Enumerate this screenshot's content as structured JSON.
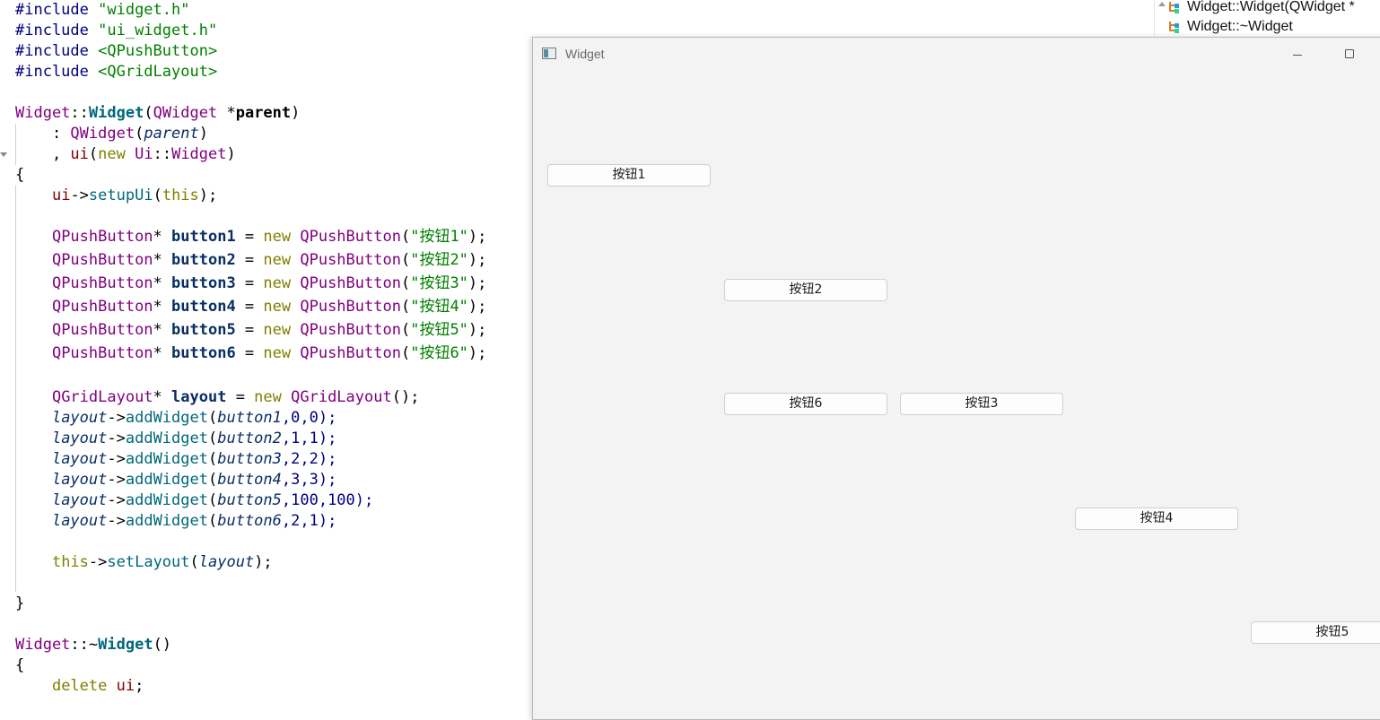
{
  "code": {
    "lines": [
      [
        {
          "t": "#include ",
          "c": "pp"
        },
        {
          "t": "\"widget.h\"",
          "c": "str"
        }
      ],
      [
        {
          "t": "#include ",
          "c": "pp"
        },
        {
          "t": "\"ui_widget.h\"",
          "c": "str"
        }
      ],
      [
        {
          "t": "#include ",
          "c": "pp"
        },
        {
          "t": "<QPushButton>",
          "c": "inc"
        }
      ],
      [
        {
          "t": "#include ",
          "c": "pp"
        },
        {
          "t": "<QGridLayout>",
          "c": "inc"
        }
      ],
      [],
      [
        {
          "t": "Widget",
          "c": "cls"
        },
        {
          "t": "::",
          "c": "op"
        },
        {
          "t": "Widget",
          "c": "fnd"
        },
        {
          "t": "(",
          "c": "op"
        },
        {
          "t": "QWidget",
          "c": "cls"
        },
        {
          "t": " *",
          "c": "op"
        },
        {
          "t": "parent",
          "c": "prmb"
        },
        {
          "t": ")",
          "c": "op"
        }
      ],
      [
        {
          "t": "    : ",
          "c": "op"
        },
        {
          "t": "QWidget",
          "c": "cls"
        },
        {
          "t": "(",
          "c": "op"
        },
        {
          "t": "parent",
          "c": "prm"
        },
        {
          "t": ")",
          "c": "op"
        }
      ],
      [
        {
          "t": "    , ",
          "c": "op"
        },
        {
          "t": "ui",
          "c": "mem"
        },
        {
          "t": "(",
          "c": "op"
        },
        {
          "t": "new ",
          "c": "kw"
        },
        {
          "t": "Ui",
          "c": "cls"
        },
        {
          "t": "::",
          "c": "op"
        },
        {
          "t": "Widget",
          "c": "cls"
        },
        {
          "t": ")",
          "c": "op"
        }
      ],
      [
        {
          "t": "{",
          "c": "op"
        }
      ],
      [
        {
          "t": "    ",
          "c": "op"
        },
        {
          "t": "ui",
          "c": "mem"
        },
        {
          "t": "->",
          "c": "op"
        },
        {
          "t": "setupUi",
          "c": "fn"
        },
        {
          "t": "(",
          "c": "op"
        },
        {
          "t": "this",
          "c": "kw"
        },
        {
          "t": ");",
          "c": "op"
        }
      ],
      [],
      [
        {
          "t": "    ",
          "c": "op"
        },
        {
          "t": "QPushButton",
          "c": "cls"
        },
        {
          "t": "* ",
          "c": "op"
        },
        {
          "t": "button1",
          "c": "loc"
        },
        {
          "t": " = ",
          "c": "op"
        },
        {
          "t": "new ",
          "c": "kw"
        },
        {
          "t": "QPushButton",
          "c": "cls"
        },
        {
          "t": "(",
          "c": "op"
        },
        {
          "t": "\"按钮1\"",
          "c": "str"
        },
        {
          "t": ");",
          "c": "op"
        }
      ],
      [
        {
          "t": "    ",
          "c": "op"
        },
        {
          "t": "QPushButton",
          "c": "cls"
        },
        {
          "t": "* ",
          "c": "op"
        },
        {
          "t": "button2",
          "c": "loc"
        },
        {
          "t": " = ",
          "c": "op"
        },
        {
          "t": "new ",
          "c": "kw"
        },
        {
          "t": "QPushButton",
          "c": "cls"
        },
        {
          "t": "(",
          "c": "op"
        },
        {
          "t": "\"按钮2\"",
          "c": "str"
        },
        {
          "t": ");",
          "c": "op"
        }
      ],
      [
        {
          "t": "    ",
          "c": "op"
        },
        {
          "t": "QPushButton",
          "c": "cls"
        },
        {
          "t": "* ",
          "c": "op"
        },
        {
          "t": "button3",
          "c": "loc"
        },
        {
          "t": " = ",
          "c": "op"
        },
        {
          "t": "new ",
          "c": "kw"
        },
        {
          "t": "QPushButton",
          "c": "cls"
        },
        {
          "t": "(",
          "c": "op"
        },
        {
          "t": "\"按钮3\"",
          "c": "str"
        },
        {
          "t": ");",
          "c": "op"
        }
      ],
      [
        {
          "t": "    ",
          "c": "op"
        },
        {
          "t": "QPushButton",
          "c": "cls"
        },
        {
          "t": "* ",
          "c": "op"
        },
        {
          "t": "button4",
          "c": "loc"
        },
        {
          "t": " = ",
          "c": "op"
        },
        {
          "t": "new ",
          "c": "kw"
        },
        {
          "t": "QPushButton",
          "c": "cls"
        },
        {
          "t": "(",
          "c": "op"
        },
        {
          "t": "\"按钮4\"",
          "c": "str"
        },
        {
          "t": ");",
          "c": "op"
        }
      ],
      [
        {
          "t": "    ",
          "c": "op"
        },
        {
          "t": "QPushButton",
          "c": "cls"
        },
        {
          "t": "* ",
          "c": "op"
        },
        {
          "t": "button5",
          "c": "loc"
        },
        {
          "t": " = ",
          "c": "op"
        },
        {
          "t": "new ",
          "c": "kw"
        },
        {
          "t": "QPushButton",
          "c": "cls"
        },
        {
          "t": "(",
          "c": "op"
        },
        {
          "t": "\"按钮5\"",
          "c": "str"
        },
        {
          "t": ");",
          "c": "op"
        }
      ],
      [
        {
          "t": "    ",
          "c": "op"
        },
        {
          "t": "QPushButton",
          "c": "cls"
        },
        {
          "t": "* ",
          "c": "op"
        },
        {
          "t": "button6",
          "c": "loc"
        },
        {
          "t": " = ",
          "c": "op"
        },
        {
          "t": "new ",
          "c": "kw"
        },
        {
          "t": "QPushButton",
          "c": "cls"
        },
        {
          "t": "(",
          "c": "op"
        },
        {
          "t": "\"按钮6\"",
          "c": "str"
        },
        {
          "t": ");",
          "c": "op"
        }
      ],
      [],
      [
        {
          "t": "    ",
          "c": "op"
        },
        {
          "t": "QGridLayout",
          "c": "cls"
        },
        {
          "t": "* ",
          "c": "op"
        },
        {
          "t": "layout",
          "c": "loc"
        },
        {
          "t": " = ",
          "c": "op"
        },
        {
          "t": "new ",
          "c": "kw"
        },
        {
          "t": "QGridLayout",
          "c": "cls"
        },
        {
          "t": "();",
          "c": "op"
        }
      ],
      [
        {
          "t": "    ",
          "c": "op"
        },
        {
          "t": "layout",
          "c": "prm"
        },
        {
          "t": "->",
          "c": "op"
        },
        {
          "t": "addWidget",
          "c": "fn"
        },
        {
          "t": "(",
          "c": "op"
        },
        {
          "t": "button1",
          "c": "prm"
        },
        {
          "t": ",0,0);",
          "c": "num"
        }
      ],
      [
        {
          "t": "    ",
          "c": "op"
        },
        {
          "t": "layout",
          "c": "prm"
        },
        {
          "t": "->",
          "c": "op"
        },
        {
          "t": "addWidget",
          "c": "fn"
        },
        {
          "t": "(",
          "c": "op"
        },
        {
          "t": "button2",
          "c": "prm"
        },
        {
          "t": ",1,1);",
          "c": "num"
        }
      ],
      [
        {
          "t": "    ",
          "c": "op"
        },
        {
          "t": "layout",
          "c": "prm"
        },
        {
          "t": "->",
          "c": "op"
        },
        {
          "t": "addWidget",
          "c": "fn"
        },
        {
          "t": "(",
          "c": "op"
        },
        {
          "t": "button3",
          "c": "prm"
        },
        {
          "t": ",2,2);",
          "c": "num"
        }
      ],
      [
        {
          "t": "    ",
          "c": "op"
        },
        {
          "t": "layout",
          "c": "prm"
        },
        {
          "t": "->",
          "c": "op"
        },
        {
          "t": "addWidget",
          "c": "fn"
        },
        {
          "t": "(",
          "c": "op"
        },
        {
          "t": "button4",
          "c": "prm"
        },
        {
          "t": ",3,3);",
          "c": "num"
        }
      ],
      [
        {
          "t": "    ",
          "c": "op"
        },
        {
          "t": "layout",
          "c": "prm"
        },
        {
          "t": "->",
          "c": "op"
        },
        {
          "t": "addWidget",
          "c": "fn"
        },
        {
          "t": "(",
          "c": "op"
        },
        {
          "t": "button5",
          "c": "prm"
        },
        {
          "t": ",100,100);",
          "c": "num"
        }
      ],
      [
        {
          "t": "    ",
          "c": "op"
        },
        {
          "t": "layout",
          "c": "prm"
        },
        {
          "t": "->",
          "c": "op"
        },
        {
          "t": "addWidget",
          "c": "fn"
        },
        {
          "t": "(",
          "c": "op"
        },
        {
          "t": "button6",
          "c": "prm"
        },
        {
          "t": ",2,1);",
          "c": "num"
        }
      ],
      [],
      [
        {
          "t": "    ",
          "c": "op"
        },
        {
          "t": "this",
          "c": "kw"
        },
        {
          "t": "->",
          "c": "op"
        },
        {
          "t": "setLayout",
          "c": "fn"
        },
        {
          "t": "(",
          "c": "op"
        },
        {
          "t": "layout",
          "c": "prm"
        },
        {
          "t": ");",
          "c": "op"
        }
      ],
      [],
      [
        {
          "t": "}",
          "c": "op"
        }
      ],
      [],
      [
        {
          "t": "Widget",
          "c": "cls"
        },
        {
          "t": "::~",
          "c": "op"
        },
        {
          "t": "Widget",
          "c": "fnd"
        },
        {
          "t": "()",
          "c": "op"
        }
      ],
      [
        {
          "t": "{",
          "c": "op"
        }
      ],
      [
        {
          "t": "    ",
          "c": "op"
        },
        {
          "t": "delete ",
          "c": "kw"
        },
        {
          "t": "ui",
          "c": "mem"
        },
        {
          "t": ";",
          "c": "op"
        }
      ]
    ]
  },
  "outline": {
    "items": [
      {
        "label": "Widget::Widget(QWidget *"
      },
      {
        "label": "Widget::~Widget"
      }
    ]
  },
  "window": {
    "title": "Widget",
    "buttons": {
      "b1": "按钮1",
      "b2": "按钮2",
      "b3": "按钮3",
      "b4": "按钮4",
      "b5": "按钮5",
      "b6": "按钮6"
    }
  },
  "colors": {
    "window_bg": "#f3f3f3",
    "string": "#008000",
    "class": "#800080",
    "function": "#00677c",
    "keyword": "#808000"
  }
}
